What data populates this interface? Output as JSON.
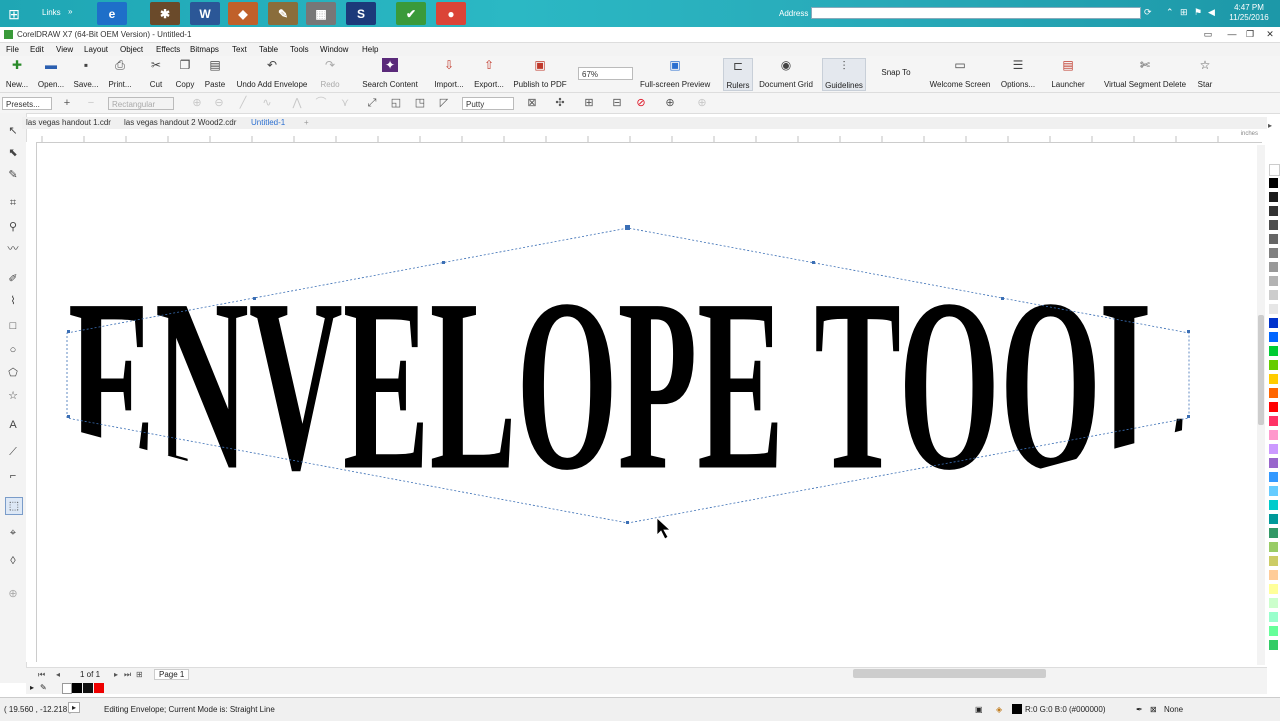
{
  "taskbar": {
    "links_label": "Links",
    "address_label": "Address",
    "address_value": "",
    "clock_time": "4:47 PM",
    "clock_date": "11/25/2016",
    "apps": [
      {
        "name": "explorer",
        "glyph": "▤",
        "color": "#d9a441"
      },
      {
        "name": "internet-explorer",
        "glyph": "e",
        "color": "#1e6fc9"
      },
      {
        "name": "coreldraw-tool",
        "glyph": "✱",
        "color": "#6a4a2a"
      },
      {
        "name": "word",
        "glyph": "W",
        "color": "#2b5797"
      },
      {
        "name": "paint",
        "glyph": "◆",
        "color": "#c0602a"
      },
      {
        "name": "pen",
        "glyph": "✎",
        "color": "#8a6d3b"
      },
      {
        "name": "printer",
        "glyph": "▦",
        "color": "#777777"
      },
      {
        "name": "app-s",
        "glyph": "S",
        "color": "#1c3a7a"
      },
      {
        "name": "coreldraw",
        "glyph": "✔",
        "color": "#3a9a3a"
      },
      {
        "name": "chrome",
        "glyph": "●",
        "color": "#db4437"
      }
    ]
  },
  "window": {
    "title": "CorelDRAW X7 (64-Bit OEM Version) - Untitled-1"
  },
  "menu": [
    "File",
    "Edit",
    "View",
    "Layout",
    "Object",
    "Effects",
    "Bitmaps",
    "Text",
    "Table",
    "Tools",
    "Window",
    "Help"
  ],
  "toolbar": {
    "new": "New...",
    "open": "Open...",
    "save": "Save...",
    "print": "Print...",
    "cut": "Cut",
    "copy": "Copy",
    "paste": "Paste",
    "undo": "Undo Add Envelope",
    "redo": "Redo",
    "search": "Search Content",
    "import": "Import...",
    "export": "Export...",
    "publish": "Publish to PDF",
    "zoom": "67%",
    "fullscreen": "Full-screen Preview",
    "rulers": "Rulers",
    "grid": "Document Grid",
    "guidelines": "Guidelines",
    "snap": "Snap To",
    "welcome": "Welcome Screen",
    "options": "Options...",
    "launcher": "Launcher",
    "vsd": "Virtual Segment Delete",
    "star": "Star"
  },
  "propbar": {
    "presets": "Presets...",
    "selection_mode": "Rectangular",
    "mapping_mode": "Putty"
  },
  "tabs": [
    "las vegas handout 1.cdr",
    "las vegas handout 2 Wood2.cdr",
    "Untitled-1",
    "+"
  ],
  "canvas": {
    "artwork_text": "ENVELOPE TOOL",
    "ruler_unit": "inches"
  },
  "pagebar": {
    "page_count": "1 of 1",
    "page_tab": "Page 1"
  },
  "status": {
    "coords": "( 19.560 , -12.218 )",
    "message": "Editing Envelope; Current Mode is: Straight Line",
    "fill_color": "R:0 G:0 B:0 (#000000)",
    "outline": "None"
  },
  "palette_colors": [
    "#ffffff",
    "#000000",
    "#1a1a1a",
    "#333333",
    "#4d4d4d",
    "#666666",
    "#808080",
    "#999999",
    "#b3b3b3",
    "#cccccc",
    "#e6e6e6",
    "#0033cc",
    "#0066ff",
    "#00cc33",
    "#66cc00",
    "#ffcc00",
    "#ff6600",
    "#ff0000",
    "#ff3366",
    "#ff99cc",
    "#cc99ff",
    "#9966cc",
    "#3399ff",
    "#66ccff",
    "#00cccc",
    "#009999",
    "#339966",
    "#99cc66",
    "#cccc66",
    "#ffcc99",
    "#ffff99",
    "#ccffcc",
    "#99ffcc",
    "#66ff99",
    "#33cc66"
  ],
  "accent_colors": {
    "selection_blue": "#2b6fd0",
    "taskbar": "#2bb8c4"
  }
}
